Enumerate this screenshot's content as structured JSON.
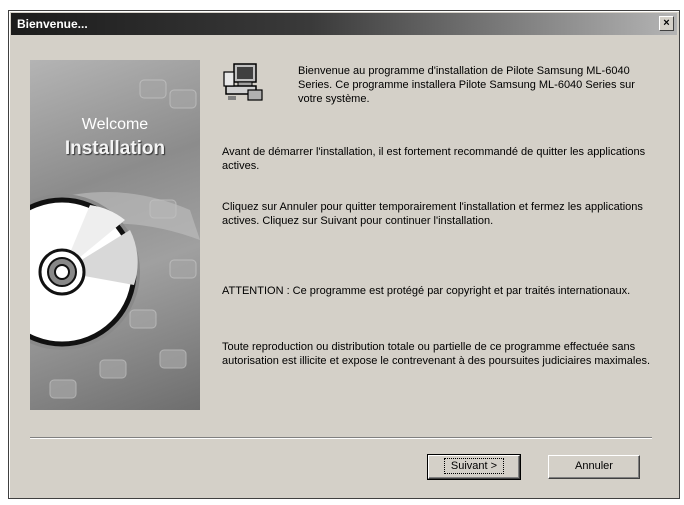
{
  "window": {
    "title": "Bienvenue...",
    "close_glyph": "×"
  },
  "banner": {
    "welcome": "Welcome",
    "installation": "Installation"
  },
  "icons": {
    "setup": "setup-computer-icon",
    "disc": "cd-disc-icon",
    "close": "close-icon"
  },
  "intro_text": "Bienvenue au programme d'installation de Pilote Samsung ML-6040 Series. Ce programme installera Pilote Samsung ML-6040 Series sur votre système.",
  "paragraphs": {
    "p1": "Avant de démarrer l'installation, il est fortement recommandé de quitter les applications actives.",
    "p2": "Cliquez sur Annuler pour quitter temporairement l'installation et fermez les applications actives. Cliquez sur Suivant pour continuer l'installation.",
    "p3": "ATTENTION : Ce programme est protégé par copyright et par traités internationaux.",
    "p4": "Toute reproduction ou distribution totale ou partielle de ce programme effectuée sans autorisation est illicite et expose le contrevenant à des poursuites judiciaires maximales."
  },
  "buttons": {
    "next": "Suivant >",
    "cancel": "Annuler"
  }
}
